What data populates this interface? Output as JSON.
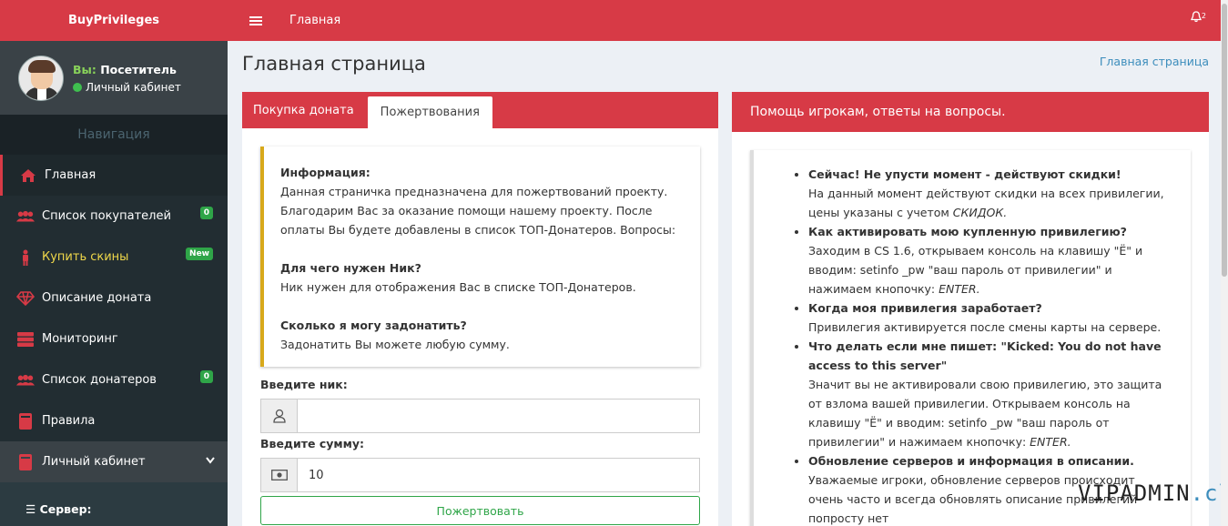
{
  "brand": "BuyPrivileges",
  "user": {
    "you_label": "Вы:",
    "role": "Посетитель",
    "cabinet": "Личный кабинет"
  },
  "nav_header": "Навигация",
  "nav": [
    {
      "label": "Главная",
      "icon": "home-icon"
    },
    {
      "label": "Список покупателей",
      "icon": "users-icon",
      "badge": "0"
    },
    {
      "label": "Купить скины",
      "icon": "person-icon",
      "badge": "New"
    },
    {
      "label": "Описание доната",
      "icon": "diamond-icon"
    },
    {
      "label": "Мониторинг",
      "icon": "server-icon"
    },
    {
      "label": "Список донатеров",
      "icon": "users-icon",
      "badge": "0"
    },
    {
      "label": "Правила",
      "icon": "book-icon"
    },
    {
      "label": "Личный кабинет",
      "icon": "book-icon"
    }
  ],
  "sub_server": "Сервер:",
  "topbar": {
    "title": "Главная",
    "notif_count": "2"
  },
  "page_title": "Главная страница",
  "breadcrumb": "Главная страница",
  "tabs": [
    "Покупка доната",
    "Пожертвования"
  ],
  "info": {
    "title": "Информация:",
    "text": "Данная страничка предназначена для пожертвований проекту. Благодарим Вас за оказание помощи нашему проекту. После оплаты Вы будете добавлены в список ТОП-Донатеров. Вопросы:",
    "q1": "Для чего нужен Ник?",
    "a1": "Ник нужен для отображения Вас в списке ТОП-Донатеров.",
    "q2": "Сколько я могу задонатить?",
    "a2": "Задонатить Вы можете любую сумму."
  },
  "form": {
    "nick_label": "Введите ник:",
    "nick_value": "",
    "sum_label": "Введите сумму:",
    "sum_value": "10",
    "submit": "Пожертвовать"
  },
  "help_title": "Помощь игрокам, ответы на вопросы.",
  "faq": [
    {
      "q": "Сейчас! Не упусти момент - действуют скидки!",
      "a": "На данный момент действуют скидки на всех привилегии, цены указаны с учетом ",
      "a_em": "СКИДОК."
    },
    {
      "q": "Как активировать мою купленную привилегию?",
      "a": "Заходим в CS 1.6, открываем консоль на клавишу \"Ё\" и вводим: setinfo _pw \"ваш пароль от привилегии\" и нажимаем кнопочку: ",
      "a_em": "ENTER."
    },
    {
      "q": "Когда моя привилегия заработает?",
      "a": "Привилегия активируется после смены карты на сервере.",
      "a_em": ""
    },
    {
      "q": "Что делать если мне пишет: \"Kicked: You do not have access to this server\"",
      "a": "Значит вы не активировали свою привилегию, это защита от взлома вашей привилегии. Открываем консоль на клавишу \"Ё\" и вводим: setinfo _pw \"ваш пароль от привилегии\" и нажимаем кнопочку: ",
      "a_em": "ENTER."
    },
    {
      "q": "Обновление серверов и информация в описании.",
      "a": "Уважаемые игроки, обновление серверов происходит очень часто и всегда обновлять описание привилегий попросту нет",
      "a_em": ""
    }
  ],
  "watermark": {
    "main": "VIPADMIN",
    "suffix": ".club"
  },
  "colors": {
    "accent": "#d73a46",
    "sidebar": "#222d32",
    "success": "#2fa548",
    "warning": "#d8a91b"
  }
}
